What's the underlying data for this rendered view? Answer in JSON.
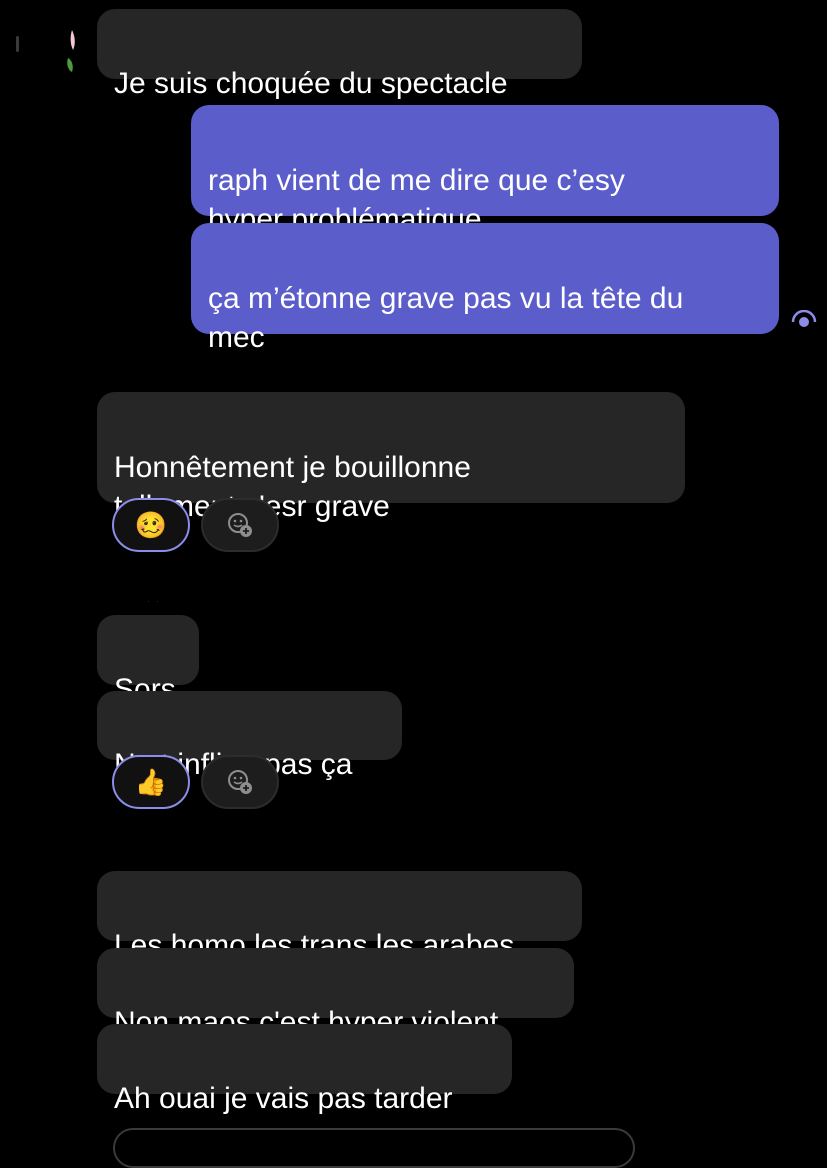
{
  "messages": {
    "m1": "Je suis choquée du spectacle",
    "m2": "raph vient de me dire que c’esy\nhyper problématique",
    "m3": "ça m’étonne grave pas vu la tête du\nmec",
    "m4": "Honnêtement je bouillonne\ntellement c'esr grave",
    "m5": "Sors",
    "m6": "Ne t inflige pas ça",
    "m7": "Les homo les trans les arabes",
    "m8": "Non maos c'est hyper violent",
    "m9": "Ah ouai je vais pas tarder"
  },
  "reactions": {
    "r1": "🥴",
    "r2": "👍"
  },
  "icons": {
    "add_reaction": "smiley-plus-icon",
    "seen": "seen-indicator-icon"
  },
  "colors": {
    "background": "#000000",
    "incoming_bubble": "#262626",
    "outgoing_bubble": "#5b5dca",
    "reaction_border": "#8b8de8"
  }
}
